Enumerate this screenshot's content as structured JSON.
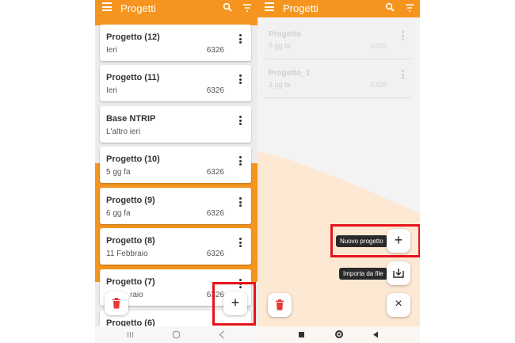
{
  "left": {
    "title": "Progetti",
    "projects": [
      {
        "name": "Progetto (12)",
        "date": "Ieri",
        "code": "6326"
      },
      {
        "name": "Progetto (11)",
        "date": "Ieri",
        "code": "6326"
      },
      {
        "name": "Base NTRIP",
        "date": "L'altro ieri",
        "code": ""
      },
      {
        "name": "Progetto (10)",
        "date": "5 gg fa",
        "code": "6326"
      },
      {
        "name": "Progetto (9)",
        "date": "6 gg fa",
        "code": "6326"
      },
      {
        "name": "Progetto (8)",
        "date": "11 Febbraio",
        "code": "6326"
      },
      {
        "name": "Progetto (7)",
        "date": "raio",
        "code": "6326"
      },
      {
        "name": "Progetto (6)",
        "date": "",
        "code": ""
      }
    ],
    "fab_plus": "+"
  },
  "right": {
    "title": "Progetti",
    "projects": [
      {
        "name": "Progetto",
        "date": "5 gg fa",
        "code": "6326"
      },
      {
        "name": "Progetto_1",
        "date": "3 gg fa",
        "code": "6326"
      }
    ],
    "menu": {
      "new_label": "Nuovo progetto",
      "new_icon": "+",
      "import_label": "Importa da file",
      "close_icon": "×"
    }
  },
  "colors": {
    "accent": "#f5951f",
    "highlight_red": "#e5141b",
    "delete_red": "#e53935"
  }
}
